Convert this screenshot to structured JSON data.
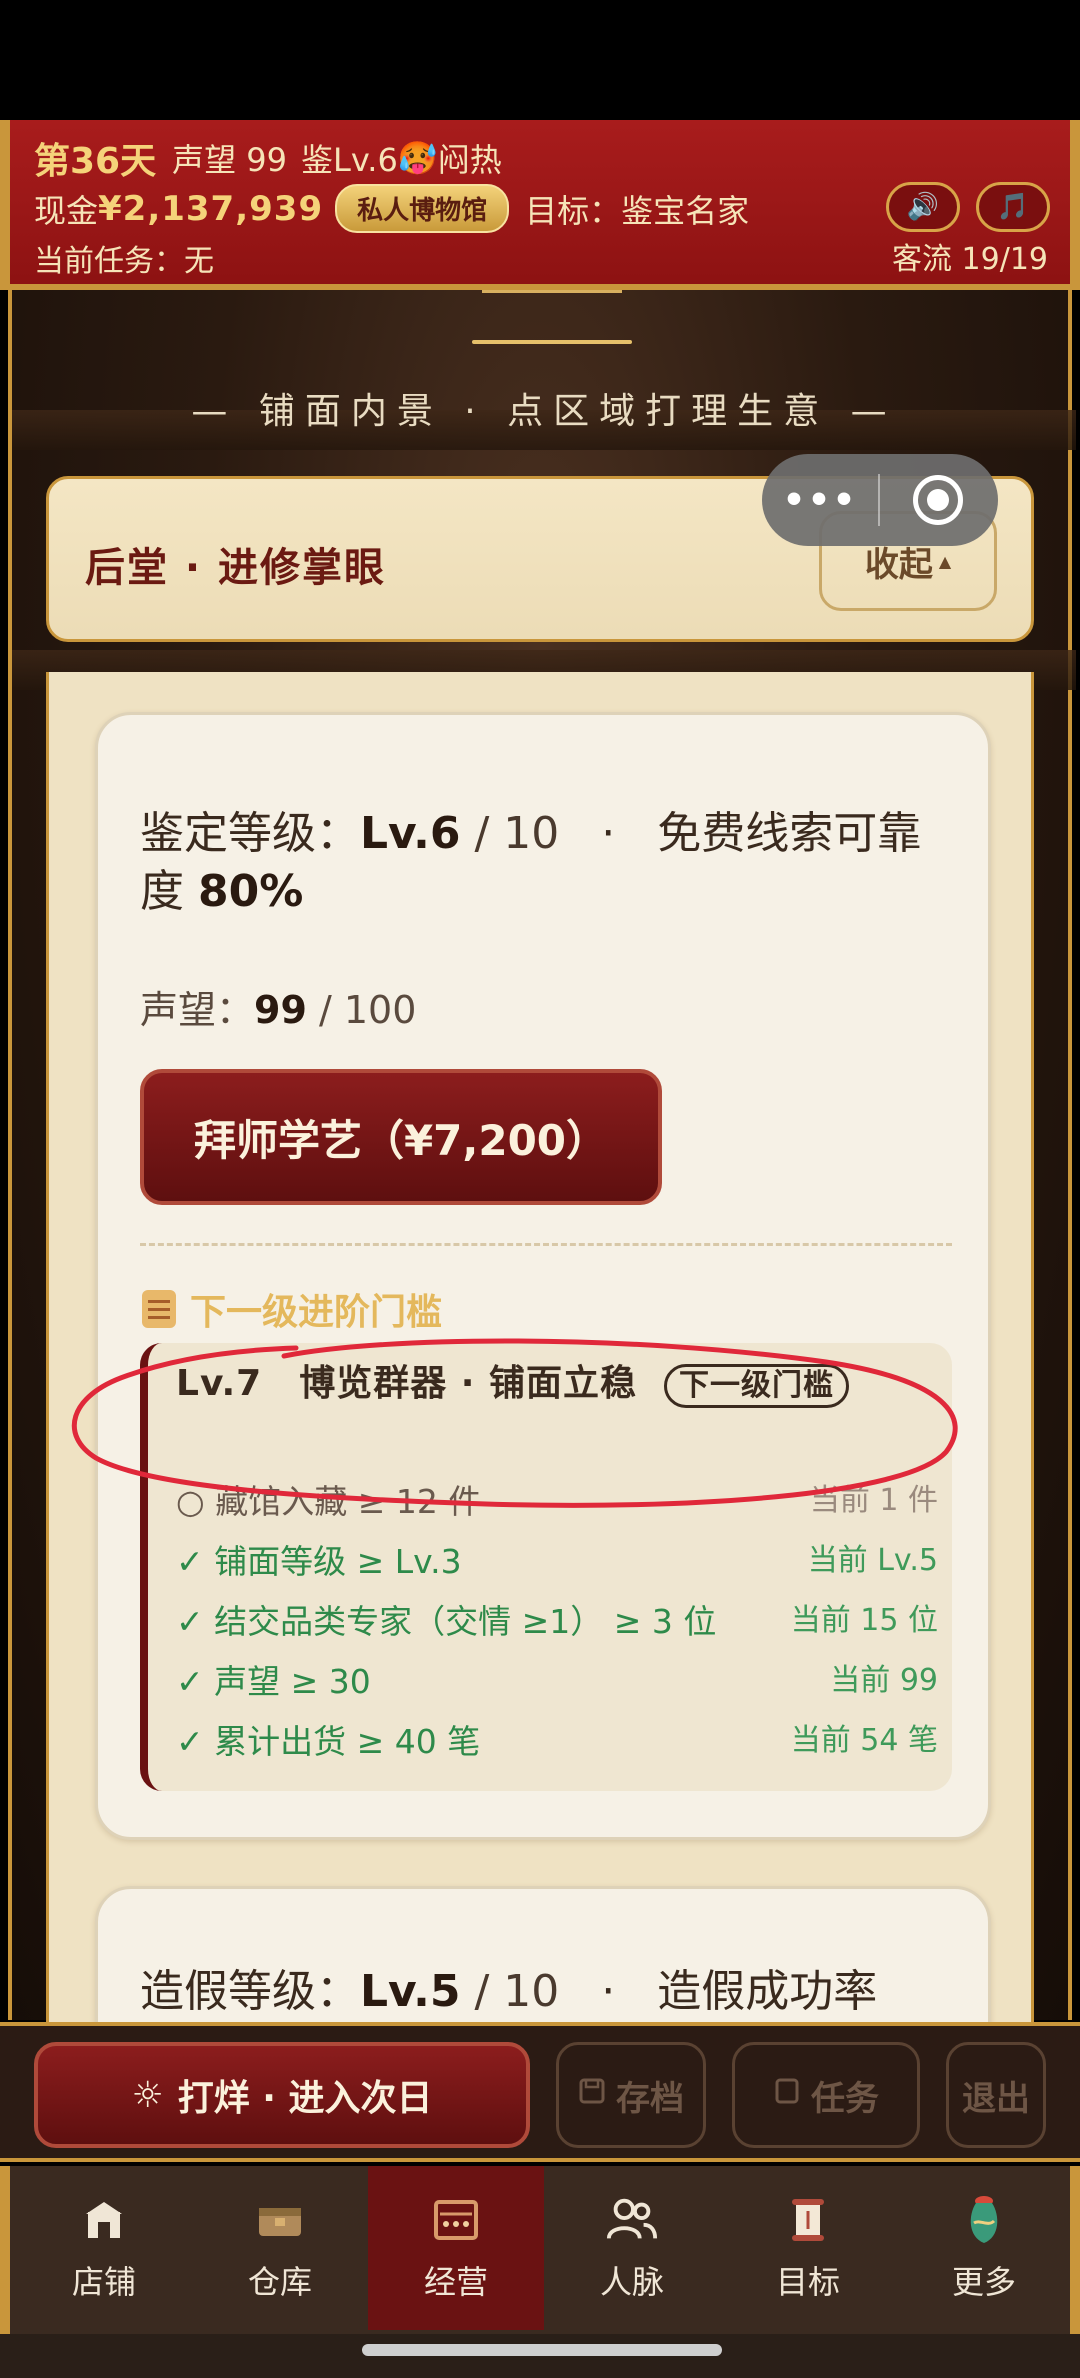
{
  "header": {
    "day": "第36天",
    "reputation": "声望 99",
    "appraisal_level": "鉴Lv.6",
    "weather_emoji": "🥵",
    "weather": "闷热",
    "cash_label": "现金",
    "cash": "¥2,137,939",
    "museum_badge": "私人博物馆",
    "goal": "目标：鉴宝名家",
    "task": "当前任务：无",
    "traffic": "客流 19/19",
    "sound_icon": "🔊",
    "music_icon": "🎵"
  },
  "scene": {
    "title": "— 铺面内景 · 点区域打理生意 —"
  },
  "section": {
    "title": "后堂 · 进修掌眼",
    "collapse_label": "收起",
    "collapse_arrow": "▲"
  },
  "capsule": {
    "more": "•••"
  },
  "appraisal_card": {
    "label": "鉴定等级：",
    "level": "Lv.6",
    "level_max": " / 10",
    "sep": "·",
    "clue_label": "免费线索可靠度",
    "clue_value": "80%",
    "rep_label": "声望：",
    "rep_value": "99",
    "rep_max": " / 100",
    "apprentice_button": "拜师学艺（¥7,200）",
    "next_title": "下一级进阶门槛",
    "threshold": {
      "head": "Lv.7　博览群器 · 铺面立稳",
      "badge": "下一级门槛",
      "conditions": [
        {
          "mark": "○",
          "text": "藏馆入藏 ≥ 12 件",
          "current": "当前 1 件",
          "met": false
        },
        {
          "mark": "✓",
          "text": "铺面等级 ≥ Lv.3",
          "current": "当前 Lv.5",
          "met": true
        },
        {
          "mark": "✓",
          "text": "结交品类专家（交情 ≥1） ≥ 3 位",
          "current": "当前 15 位",
          "met": true
        },
        {
          "mark": "✓",
          "text": "声望 ≥ 30",
          "current": "当前 99",
          "met": true
        },
        {
          "mark": "✓",
          "text": "累计出货 ≥ 40 笔",
          "current": "当前 54 笔",
          "met": true
        }
      ]
    }
  },
  "forgery_card": {
    "label": "造假等级：",
    "level": "Lv.5",
    "level_max": " / 10",
    "sep": "·",
    "rate_label": "造假成功率"
  },
  "action_bar": {
    "next_day": "打烊 · 进入次日",
    "sun_icon": "☼",
    "save": "存档",
    "task": "任务",
    "exit": "退出"
  },
  "nav": {
    "items": [
      {
        "label": "店铺",
        "icon": "shop-icon",
        "active": false
      },
      {
        "label": "仓库",
        "icon": "warehouse-icon",
        "active": false
      },
      {
        "label": "经营",
        "icon": "abacus-icon",
        "active": true
      },
      {
        "label": "人脉",
        "icon": "people-icon",
        "active": false
      },
      {
        "label": "目标",
        "icon": "scroll-icon",
        "active": false
      },
      {
        "label": "更多",
        "icon": "vase-icon",
        "active": false
      }
    ]
  },
  "colors": {
    "header_red": "#9a1717",
    "gold": "#c9963b",
    "button_red": "#6e1414",
    "met_green": "#2e8a4a",
    "annotation_red": "#e0283a"
  }
}
